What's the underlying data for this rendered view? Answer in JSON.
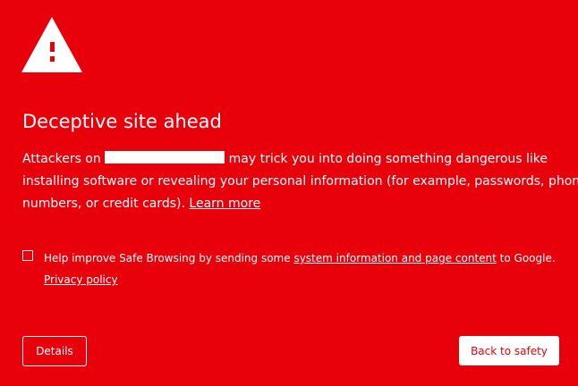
{
  "interstitial": {
    "title": "Deceptive site ahead",
    "body_prefix": "Attackers on",
    "body_line1_suffix": " may trick you into doing something dangerous like",
    "body_line2": "installing software or revealing your personal information (for example, passwords, phone",
    "body_line3_prefix": "numbers, or credit cards).",
    "learn_more": "Learn more"
  },
  "safe_browsing": {
    "checked": false,
    "label_prefix": "Help improve Safe Browsing by sending some ",
    "label_link": "system information and page content",
    "label_suffix": " to Google.",
    "privacy_link": "Privacy policy"
  },
  "buttons": {
    "details": "Details",
    "back_to_safety": "Back to safety"
  },
  "colors": {
    "background": "#e8000b",
    "foreground": "#ffffff"
  },
  "icons": {
    "warning": "warning-triangle-icon"
  }
}
